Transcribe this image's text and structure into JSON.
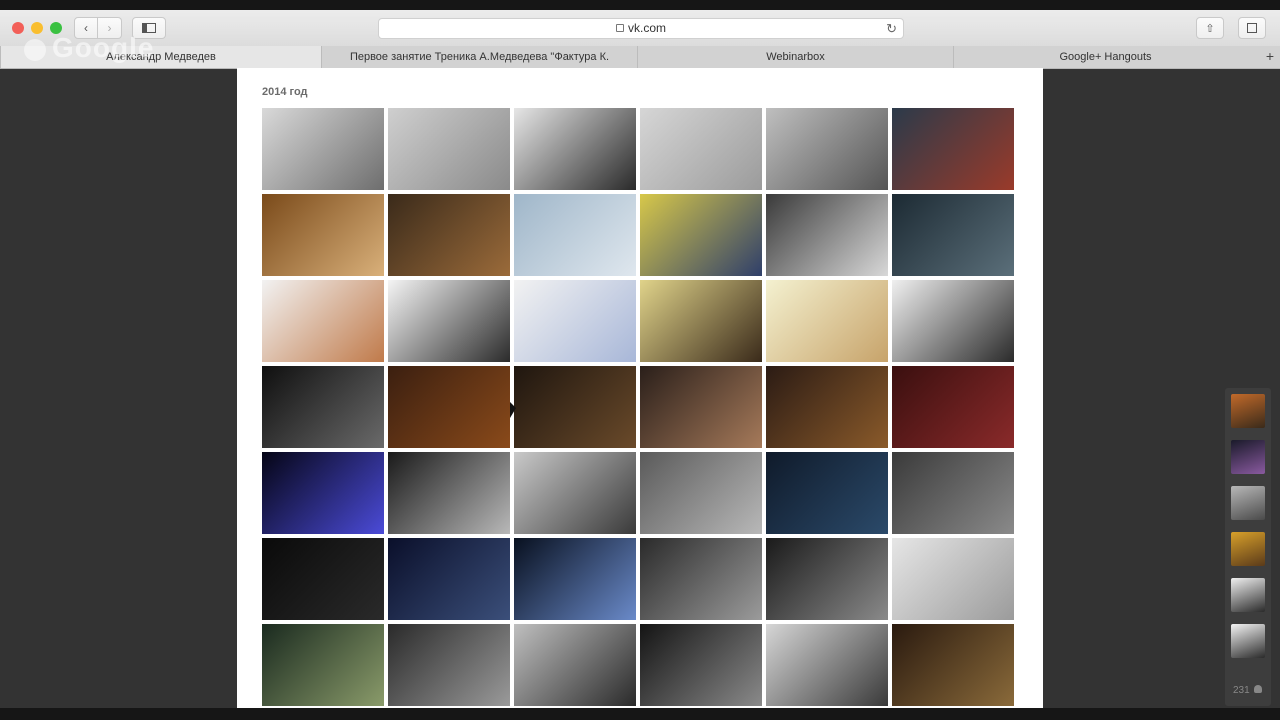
{
  "browser": {
    "url": "vk.com",
    "tabs": [
      {
        "label": "Александр Медведев",
        "active": true
      },
      {
        "label": "Первое занятие Треника А.Медведева \"Фактура К.",
        "active": false
      },
      {
        "label": "Webinarbox",
        "active": false
      },
      {
        "label": "Google+ Hangouts",
        "active": false
      }
    ],
    "watermark": "Google"
  },
  "page": {
    "year_label": "2014 год",
    "photos": [
      {
        "colors": [
          "#d9d9d9",
          "#6e6e6e"
        ]
      },
      {
        "colors": [
          "#cfcfcf",
          "#8a8a8a"
        ]
      },
      {
        "colors": [
          "#e6e6e6",
          "#2a2a2a"
        ]
      },
      {
        "colors": [
          "#d6d6d6",
          "#9b9b9b"
        ]
      },
      {
        "colors": [
          "#bfbfbf",
          "#555555"
        ]
      },
      {
        "colors": [
          "#2b3a4a",
          "#9a3a2a"
        ]
      },
      {
        "colors": [
          "#7a4a1a",
          "#d9b07a"
        ]
      },
      {
        "colors": [
          "#3a2a1a",
          "#9b6b3a"
        ]
      },
      {
        "colors": [
          "#9fb6c9",
          "#dfe7ee"
        ]
      },
      {
        "colors": [
          "#d7c84a",
          "#2f3f6a"
        ]
      },
      {
        "colors": [
          "#3a3a3a",
          "#d8d8d8"
        ]
      },
      {
        "colors": [
          "#1c2a33",
          "#5b6f7a"
        ]
      },
      {
        "colors": [
          "#f2f2f2",
          "#c07a4a"
        ]
      },
      {
        "colors": [
          "#f5f5f5",
          "#2b2b2b"
        ]
      },
      {
        "colors": [
          "#f2f2f2",
          "#a8b7d8"
        ]
      },
      {
        "colors": [
          "#e0d38a",
          "#3a2a1a"
        ]
      },
      {
        "colors": [
          "#f4f1d0",
          "#c7a36a"
        ]
      },
      {
        "colors": [
          "#f0f0f0",
          "#2a2a2a"
        ]
      },
      {
        "colors": [
          "#0f0f0f",
          "#6a6a6a"
        ]
      },
      {
        "colors": [
          "#3b1f10",
          "#8a4a1a"
        ]
      },
      {
        "colors": [
          "#1f160f",
          "#6a4a2a"
        ]
      },
      {
        "colors": [
          "#2a1f1a",
          "#a67a5a"
        ]
      },
      {
        "colors": [
          "#2b1b14",
          "#8a5a2a"
        ]
      },
      {
        "colors": [
          "#3a0f0f",
          "#8a2a2a"
        ]
      },
      {
        "colors": [
          "#050515",
          "#4b4bd8"
        ]
      },
      {
        "colors": [
          "#1a1a1a",
          "#b8b8b8"
        ]
      },
      {
        "colors": [
          "#c9c9c9",
          "#3a3a3a"
        ]
      },
      {
        "colors": [
          "#5a5a5a",
          "#b8b8b8"
        ]
      },
      {
        "colors": [
          "#0f1a2a",
          "#2b4a6a"
        ]
      },
      {
        "colors": [
          "#3a3a3a",
          "#8a8a8a"
        ]
      },
      {
        "colors": [
          "#0a0a0a",
          "#2a2a2a"
        ]
      },
      {
        "colors": [
          "#0a0f2a",
          "#3b4f7a"
        ]
      },
      {
        "colors": [
          "#08101f",
          "#6a8ac9"
        ]
      },
      {
        "colors": [
          "#2a2a2a",
          "#9b9b9b"
        ]
      },
      {
        "colors": [
          "#1a1a1a",
          "#8a8a8a"
        ]
      },
      {
        "colors": [
          "#e6e6e6",
          "#9b9b9b"
        ]
      },
      {
        "colors": [
          "#1a2a1f",
          "#8a9b6a"
        ]
      },
      {
        "colors": [
          "#2a2a2a",
          "#9a9a9a"
        ]
      },
      {
        "colors": [
          "#bfbfbf",
          "#2a2a2a"
        ]
      },
      {
        "colors": [
          "#141414",
          "#8a8a8a"
        ]
      },
      {
        "colors": [
          "#d6d6d6",
          "#3a3a3a"
        ]
      },
      {
        "colors": [
          "#2a1a0f",
          "#8a6a3a"
        ]
      }
    ]
  },
  "hangout": {
    "participant_count": "231",
    "avatars": [
      {
        "colors": [
          "#c26a2a",
          "#3a2a1a"
        ]
      },
      {
        "colors": [
          "#1a1a2a",
          "#8a5aa0"
        ]
      },
      {
        "colors": [
          "#b8b8b8",
          "#4a4a4a"
        ]
      },
      {
        "colors": [
          "#d8a02a",
          "#5a3a1a"
        ]
      },
      {
        "colors": [
          "#f0f0f0",
          "#2a2a2a"
        ]
      },
      {
        "colors": [
          "#f5f5f5",
          "#2a2a2a"
        ]
      }
    ]
  }
}
